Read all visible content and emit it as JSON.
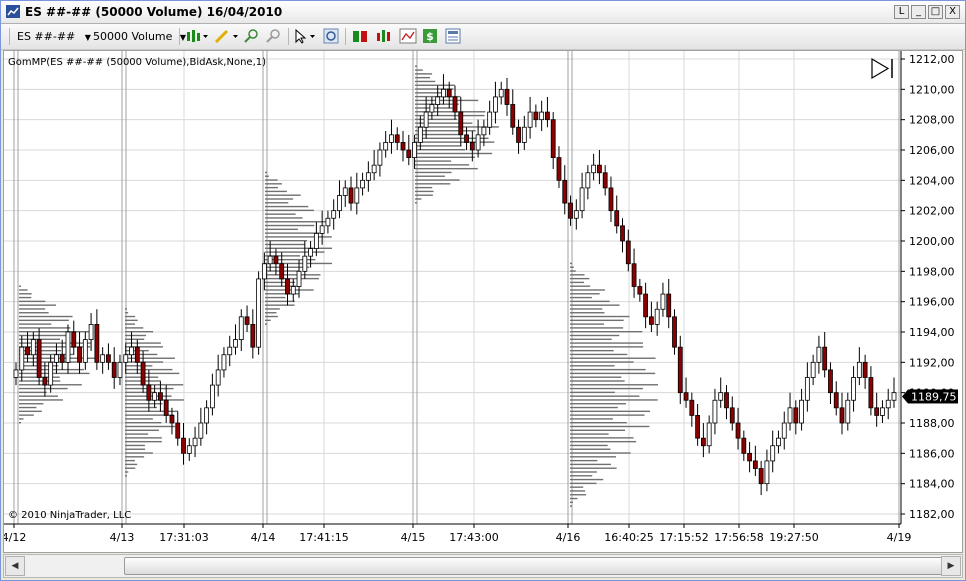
{
  "window": {
    "title": "ES ##-## (50000 Volume)  16/04/2010",
    "buttons": [
      "L",
      "_",
      "□",
      "X"
    ]
  },
  "toolbar": {
    "instrument": "ES ##-##",
    "period": "50000 Volume"
  },
  "chart": {
    "indicator_label": "GomMP(ES ##-## (50000 Volume),BidAsk,None,1)",
    "copyright": "© 2010 NinjaTrader, LLC",
    "current_price": "1189,75",
    "colors": {
      "up": "#ffffff",
      "down": "#8b0000",
      "wick": "#000000",
      "profile": "#707070",
      "grid": "#d8d8d8",
      "session": "#a0a0a0",
      "price_tag": "#000000"
    },
    "y_ticks": [
      "1212,00",
      "1210,00",
      "1208,00",
      "1206,00",
      "1204,00",
      "1202,00",
      "1200,00",
      "1198,00",
      "1196,00",
      "1194,00",
      "1192,00",
      "1190,00",
      "1188,00",
      "1186,00",
      "1184,00",
      "1182,00"
    ],
    "x_labels": [
      "4/12",
      "4/13",
      "17:31:03",
      "4/14",
      "17:41:15",
      "4/15",
      "17:43:00",
      "4/16",
      "16:40:25",
      "17:15:52",
      "17:56:58",
      "19:27:50",
      "4/19"
    ]
  },
  "chart_data": {
    "type": "candlestick",
    "ylim": [
      1181.5,
      1212.5
    ],
    "y_ticks": [
      1212,
      1210,
      1208,
      1206,
      1204,
      1202,
      1200,
      1198,
      1196,
      1194,
      1192,
      1190,
      1188,
      1186,
      1184,
      1182
    ],
    "last_price": 1189.75,
    "x_labels": [
      "4/12",
      "4/13",
      "17:31:03",
      "4/14",
      "17:41:15",
      "4/15",
      "17:43:00",
      "4/16",
      "16:40:25",
      "17:15:52",
      "17:56:58",
      "19:27:50",
      "4/19"
    ],
    "closes": [
      1191.5,
      1193.0,
      1192.5,
      1193.5,
      1191.0,
      1190.5,
      1192.0,
      1192.5,
      1192.0,
      1194.0,
      1193.0,
      1192.0,
      1193.5,
      1194.5,
      1192.0,
      1192.5,
      1192.0,
      1191.0,
      1192.0,
      1192.5,
      1193.0,
      1192.0,
      1190.5,
      1189.5,
      1190.0,
      1189.5,
      1188.5,
      1188.0,
      1187.0,
      1186.0,
      1186.5,
      1187.0,
      1188.0,
      1189.0,
      1190.5,
      1191.5,
      1192.5,
      1193.0,
      1193.5,
      1195.0,
      1194.5,
      1193.0,
      1197.5,
      1198.5,
      1199.0,
      1198.5,
      1197.5,
      1196.5,
      1197.0,
      1198.0,
      1199.0,
      1199.5,
      1200.5,
      1201.0,
      1201.5,
      1202.0,
      1203.0,
      1203.5,
      1202.5,
      1203.5,
      1204.0,
      1204.5,
      1205.0,
      1206.0,
      1206.5,
      1207.0,
      1206.5,
      1206.0,
      1205.5,
      1206.5,
      1207.5,
      1208.5,
      1209.0,
      1209.5,
      1210.0,
      1209.5,
      1208.5,
      1207.0,
      1206.5,
      1206.0,
      1207.0,
      1207.5,
      1208.5,
      1209.5,
      1210.0,
      1209.0,
      1207.5,
      1206.5,
      1207.5,
      1208.5,
      1208.0,
      1208.5,
      1208.0,
      1205.5,
      1204.0,
      1202.5,
      1201.5,
      1202.0,
      1203.5,
      1204.5,
      1205.0,
      1204.5,
      1203.5,
      1202.0,
      1201.0,
      1200.0,
      1198.5,
      1197.0,
      1196.5,
      1195.0,
      1194.5,
      1195.5,
      1196.5,
      1195.0,
      1193.0,
      1190.0,
      1189.5,
      1188.5,
      1187.0,
      1186.5,
      1188.0,
      1189.5,
      1190.0,
      1189.0,
      1188.0,
      1187.0,
      1186.0,
      1185.5,
      1185.0,
      1184.0,
      1185.5,
      1186.5,
      1187.0,
      1188.0,
      1189.0,
      1188.0,
      1189.5,
      1191.0,
      1192.0,
      1193.0,
      1191.5,
      1190.0,
      1189.0,
      1188.0,
      1189.5,
      1191.0,
      1192.0,
      1191.0,
      1189.0,
      1188.5,
      1189.0,
      1189.5,
      1190.0
    ]
  }
}
